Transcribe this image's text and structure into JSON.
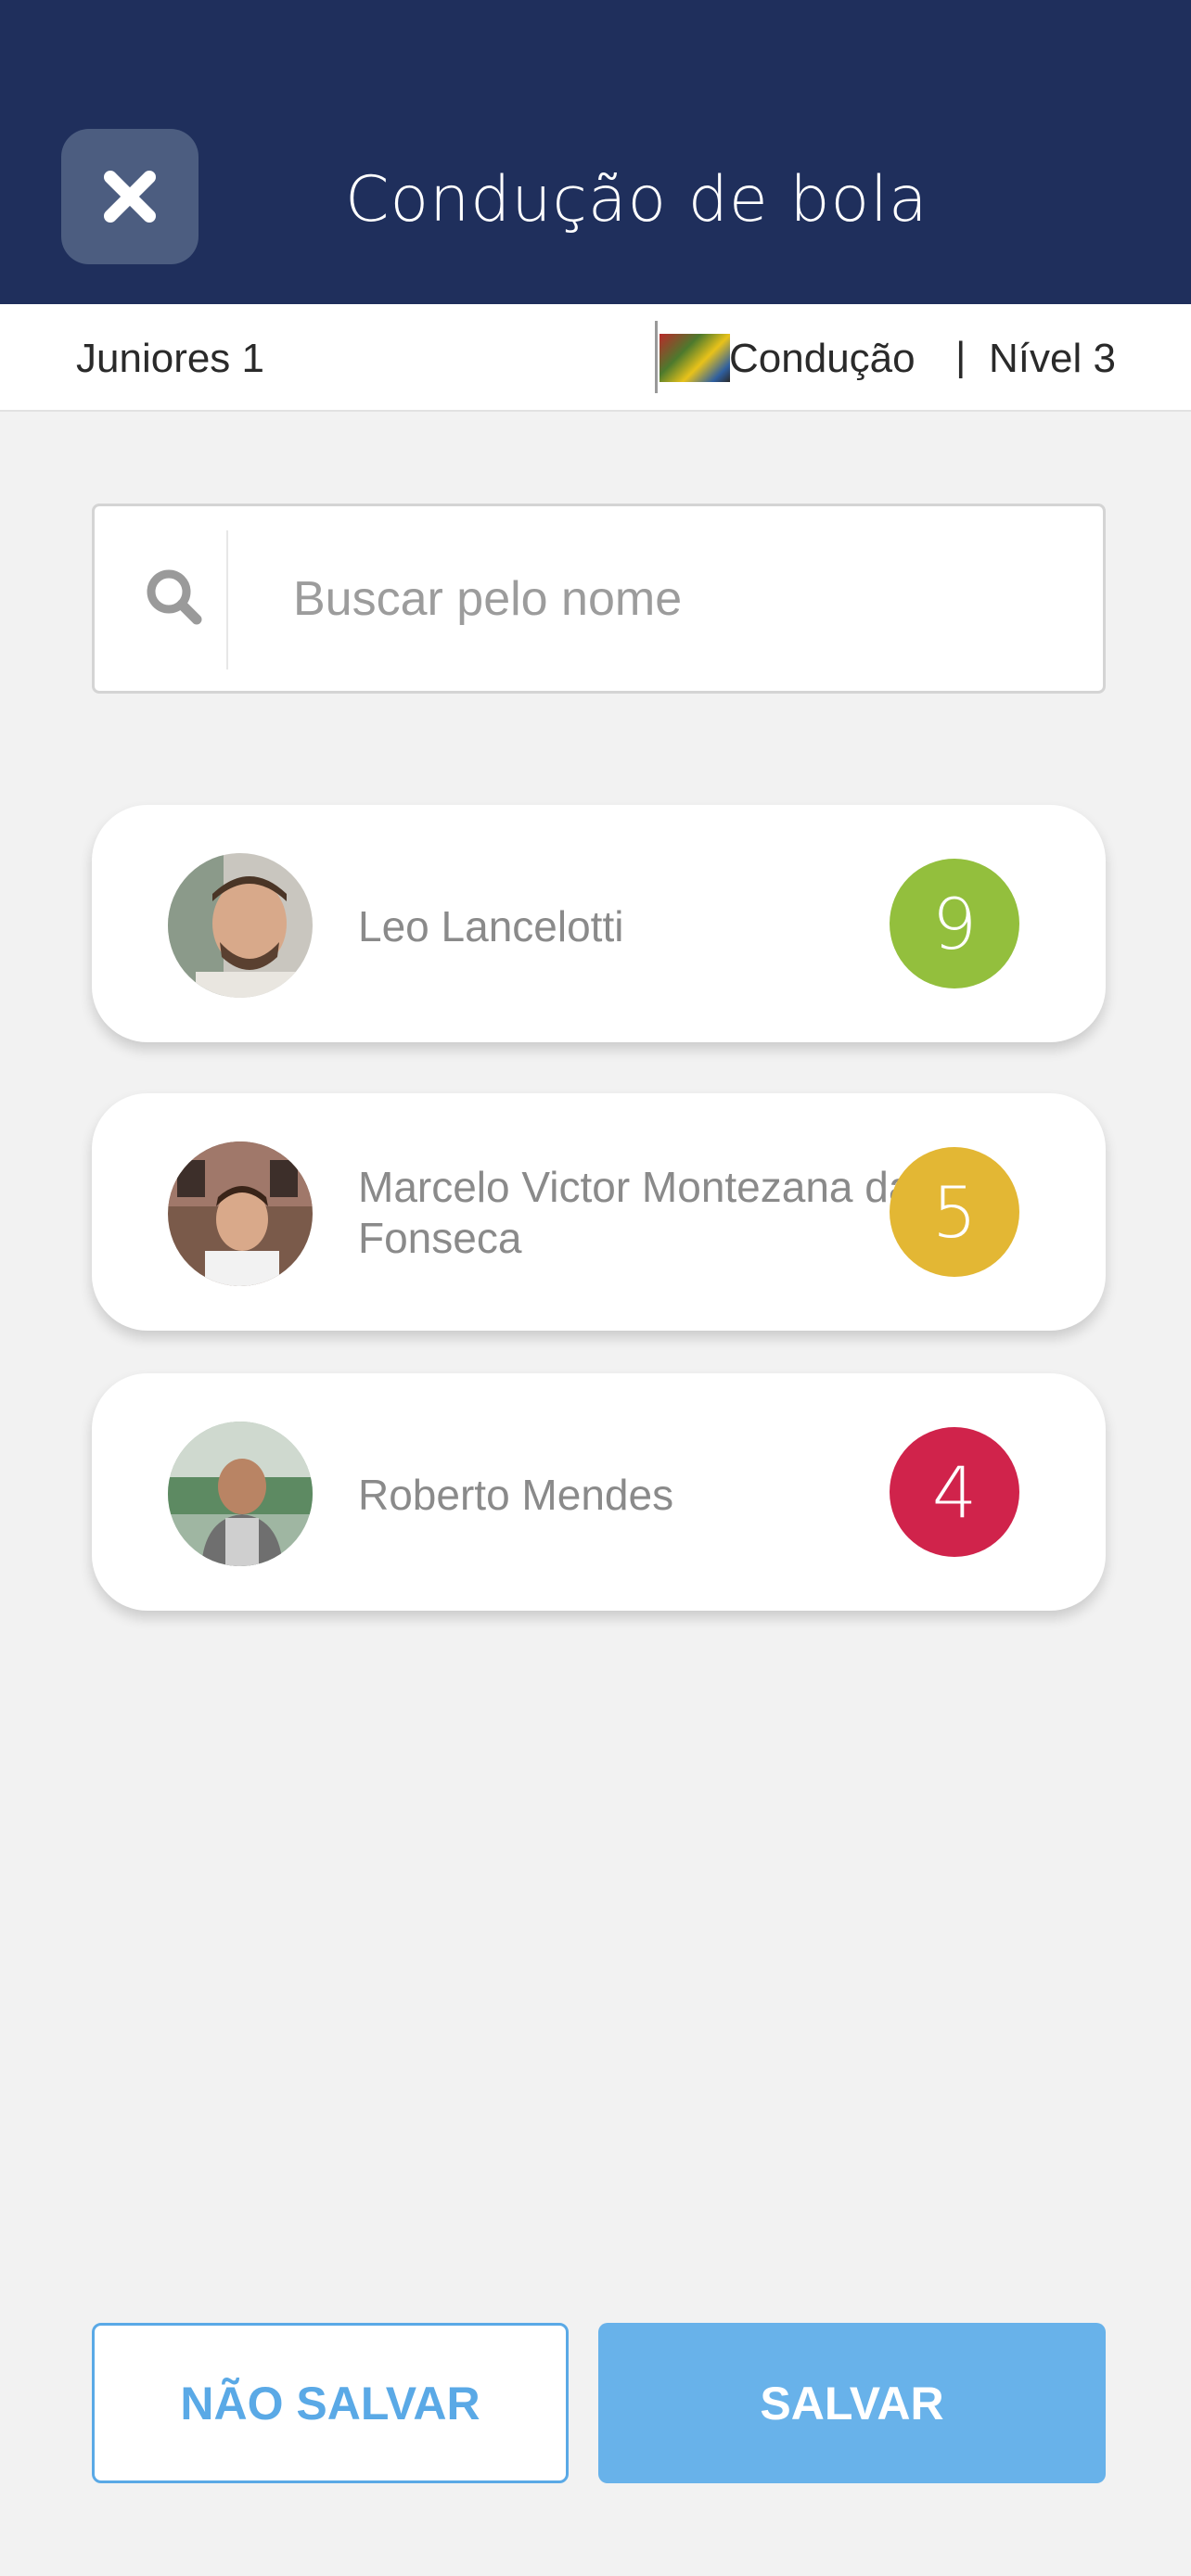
{
  "header": {
    "title": "Condução de bola",
    "close_icon": "close-icon",
    "background": "#1f2f5c"
  },
  "info_bar": {
    "team": "Juniores 1",
    "skill": "Condução",
    "separator": "|",
    "level": "Nível 3"
  },
  "search": {
    "placeholder": "Buscar pelo nome",
    "value": "",
    "icon": "search-icon"
  },
  "players": [
    {
      "name": "Leo Lancelotti",
      "score": "9",
      "score_color": "#93bf3d"
    },
    {
      "name": "Marcelo Victor Montezana da Fonseca",
      "score": "5",
      "score_color": "#e3b734"
    },
    {
      "name": "Roberto  Mendes",
      "score": "4",
      "score_color": "#d0234b"
    }
  ],
  "actions": {
    "cancel_label": "NÃO SALVAR",
    "save_label": "SALVAR"
  }
}
